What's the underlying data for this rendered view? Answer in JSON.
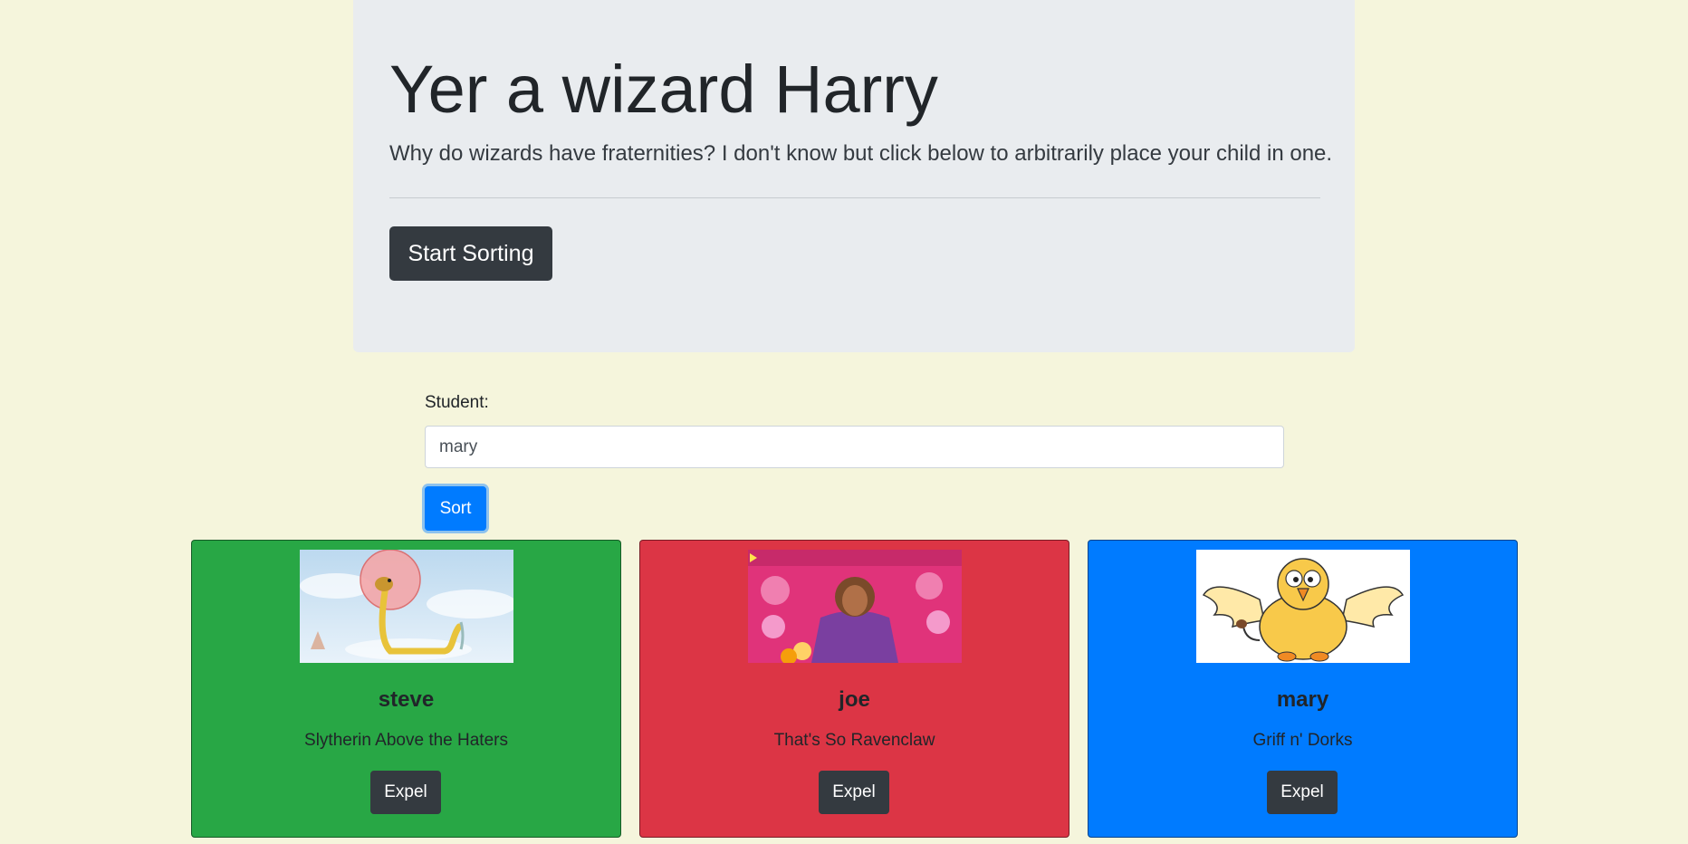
{
  "hero": {
    "title": "Yer a wizard Harry",
    "lead": "Why do wizards have fraternities? I don't know but click below to arbitrarily place your child in one.",
    "start_button": "Start Sorting"
  },
  "form": {
    "label": "Student:",
    "input_value": "mary",
    "sort_button": "Sort"
  },
  "cards": [
    {
      "name": "steve",
      "house": "Slytherin Above the Haters",
      "button": "Expel",
      "color": "#28a745",
      "image": "snake-balloon-image"
    },
    {
      "name": "joe",
      "house": "That's So Ravenclaw",
      "button": "Expel",
      "color": "#dc3545",
      "image": "thats-so-raven-poster-image"
    },
    {
      "name": "mary",
      "house": "Griff n' Dorks",
      "button": "Expel",
      "color": "#007bff",
      "image": "cartoon-griffin-image"
    }
  ],
  "colors": {
    "page_bg": "#f5f5dc",
    "jumbotron_bg": "#e9ecef",
    "dark_button": "#343a40",
    "primary": "#007bff",
    "success": "#28a745",
    "danger": "#dc3545"
  }
}
